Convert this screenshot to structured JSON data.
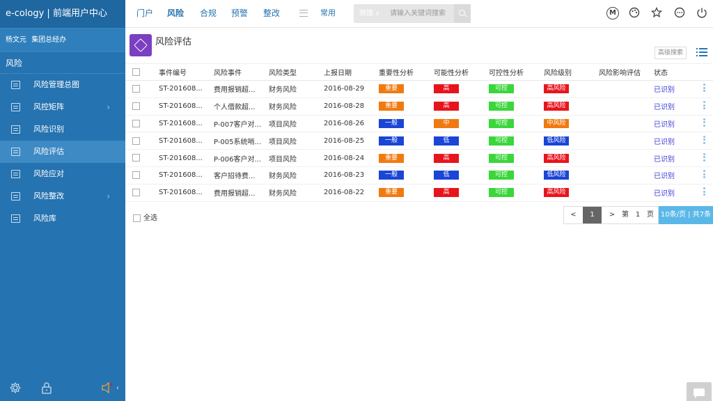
{
  "sidebar": {
    "brand": "e-cology | 前端用户中心",
    "user_name": "杨文元",
    "user_org": "集团总经办",
    "section": "风险",
    "items": [
      {
        "label": "风险管理总图",
        "has_children": false
      },
      {
        "label": "风控矩阵",
        "has_children": true
      },
      {
        "label": "风险识别",
        "has_children": false
      },
      {
        "label": "风险评估",
        "has_children": false
      },
      {
        "label": "风险应对",
        "has_children": false
      },
      {
        "label": "风险整改",
        "has_children": true
      },
      {
        "label": "风险库",
        "has_children": false
      }
    ],
    "active_index": 3
  },
  "topnav": {
    "tabs": [
      "门户",
      "风险",
      "合规",
      "预警",
      "整改"
    ],
    "active_tab": "风险",
    "common_label": "常用",
    "search_scope": "微搜",
    "search_placeholder": "请输入关键词搜索"
  },
  "page": {
    "title": "风险评估",
    "advanced_search": "高级搜索"
  },
  "table": {
    "columns": [
      "事件编号",
      "风险事件",
      "风险类型",
      "上报日期",
      "重要性分析",
      "可能性分析",
      "可控性分析",
      "风险级别",
      "风险影响评估",
      "状态"
    ],
    "rows": [
      {
        "id": "ST-201608...",
        "event": "费用报销超...",
        "type": "财务风险",
        "date": "2016-08-29",
        "importance": "重要",
        "likelihood": "高",
        "controllability": "可控",
        "level": "高风险",
        "impact": "",
        "status": "已识别"
      },
      {
        "id": "ST-201608...",
        "event": "个人借款超...",
        "type": "财务风险",
        "date": "2016-08-28",
        "importance": "重要",
        "likelihood": "高",
        "controllability": "可控",
        "level": "高风险",
        "impact": "",
        "status": "已识别"
      },
      {
        "id": "ST-201608...",
        "event": "P-007客户对...",
        "type": "项目风险",
        "date": "2016-08-26",
        "importance": "一般",
        "likelihood": "中",
        "controllability": "可控",
        "level": "中风险",
        "impact": "",
        "status": "已识别"
      },
      {
        "id": "ST-201608...",
        "event": "P-005系统哨...",
        "type": "项目风险",
        "date": "2016-08-25",
        "importance": "一般",
        "likelihood": "低",
        "controllability": "可控",
        "level": "低风险",
        "impact": "",
        "status": "已识别"
      },
      {
        "id": "ST-201608...",
        "event": "P-006客户对...",
        "type": "项目风险",
        "date": "2016-08-24",
        "importance": "重要",
        "likelihood": "高",
        "controllability": "可控",
        "level": "高风险",
        "impact": "",
        "status": "已识别"
      },
      {
        "id": "ST-201608...",
        "event": "客户招待费...",
        "type": "财务风险",
        "date": "2016-08-23",
        "importance": "一般",
        "likelihood": "低",
        "controllability": "可控",
        "level": "低风险",
        "impact": "",
        "status": "已识别"
      },
      {
        "id": "ST-201608...",
        "event": "费用报销超...",
        "type": "财务风险",
        "date": "2016-08-22",
        "importance": "重要",
        "likelihood": "高",
        "controllability": "可控",
        "level": "高风险",
        "impact": "",
        "status": "已识别"
      }
    ]
  },
  "footer": {
    "select_all": "全选",
    "prev": "<",
    "next": ">",
    "current_page": "1",
    "goto_prefix": "第",
    "goto_value": "1",
    "goto_suffix": "页",
    "page_size_info": "10条/页 | 共7条"
  },
  "colors": {
    "重要": "#f07a10",
    "一般": "#1a45d6",
    "高": "#e8141c",
    "中": "#f07a10",
    "低": "#1a45d6",
    "可控": "#3ad63a",
    "高风险": "#e8141c",
    "中风险": "#f07a10",
    "低风险": "#1a45d6"
  }
}
